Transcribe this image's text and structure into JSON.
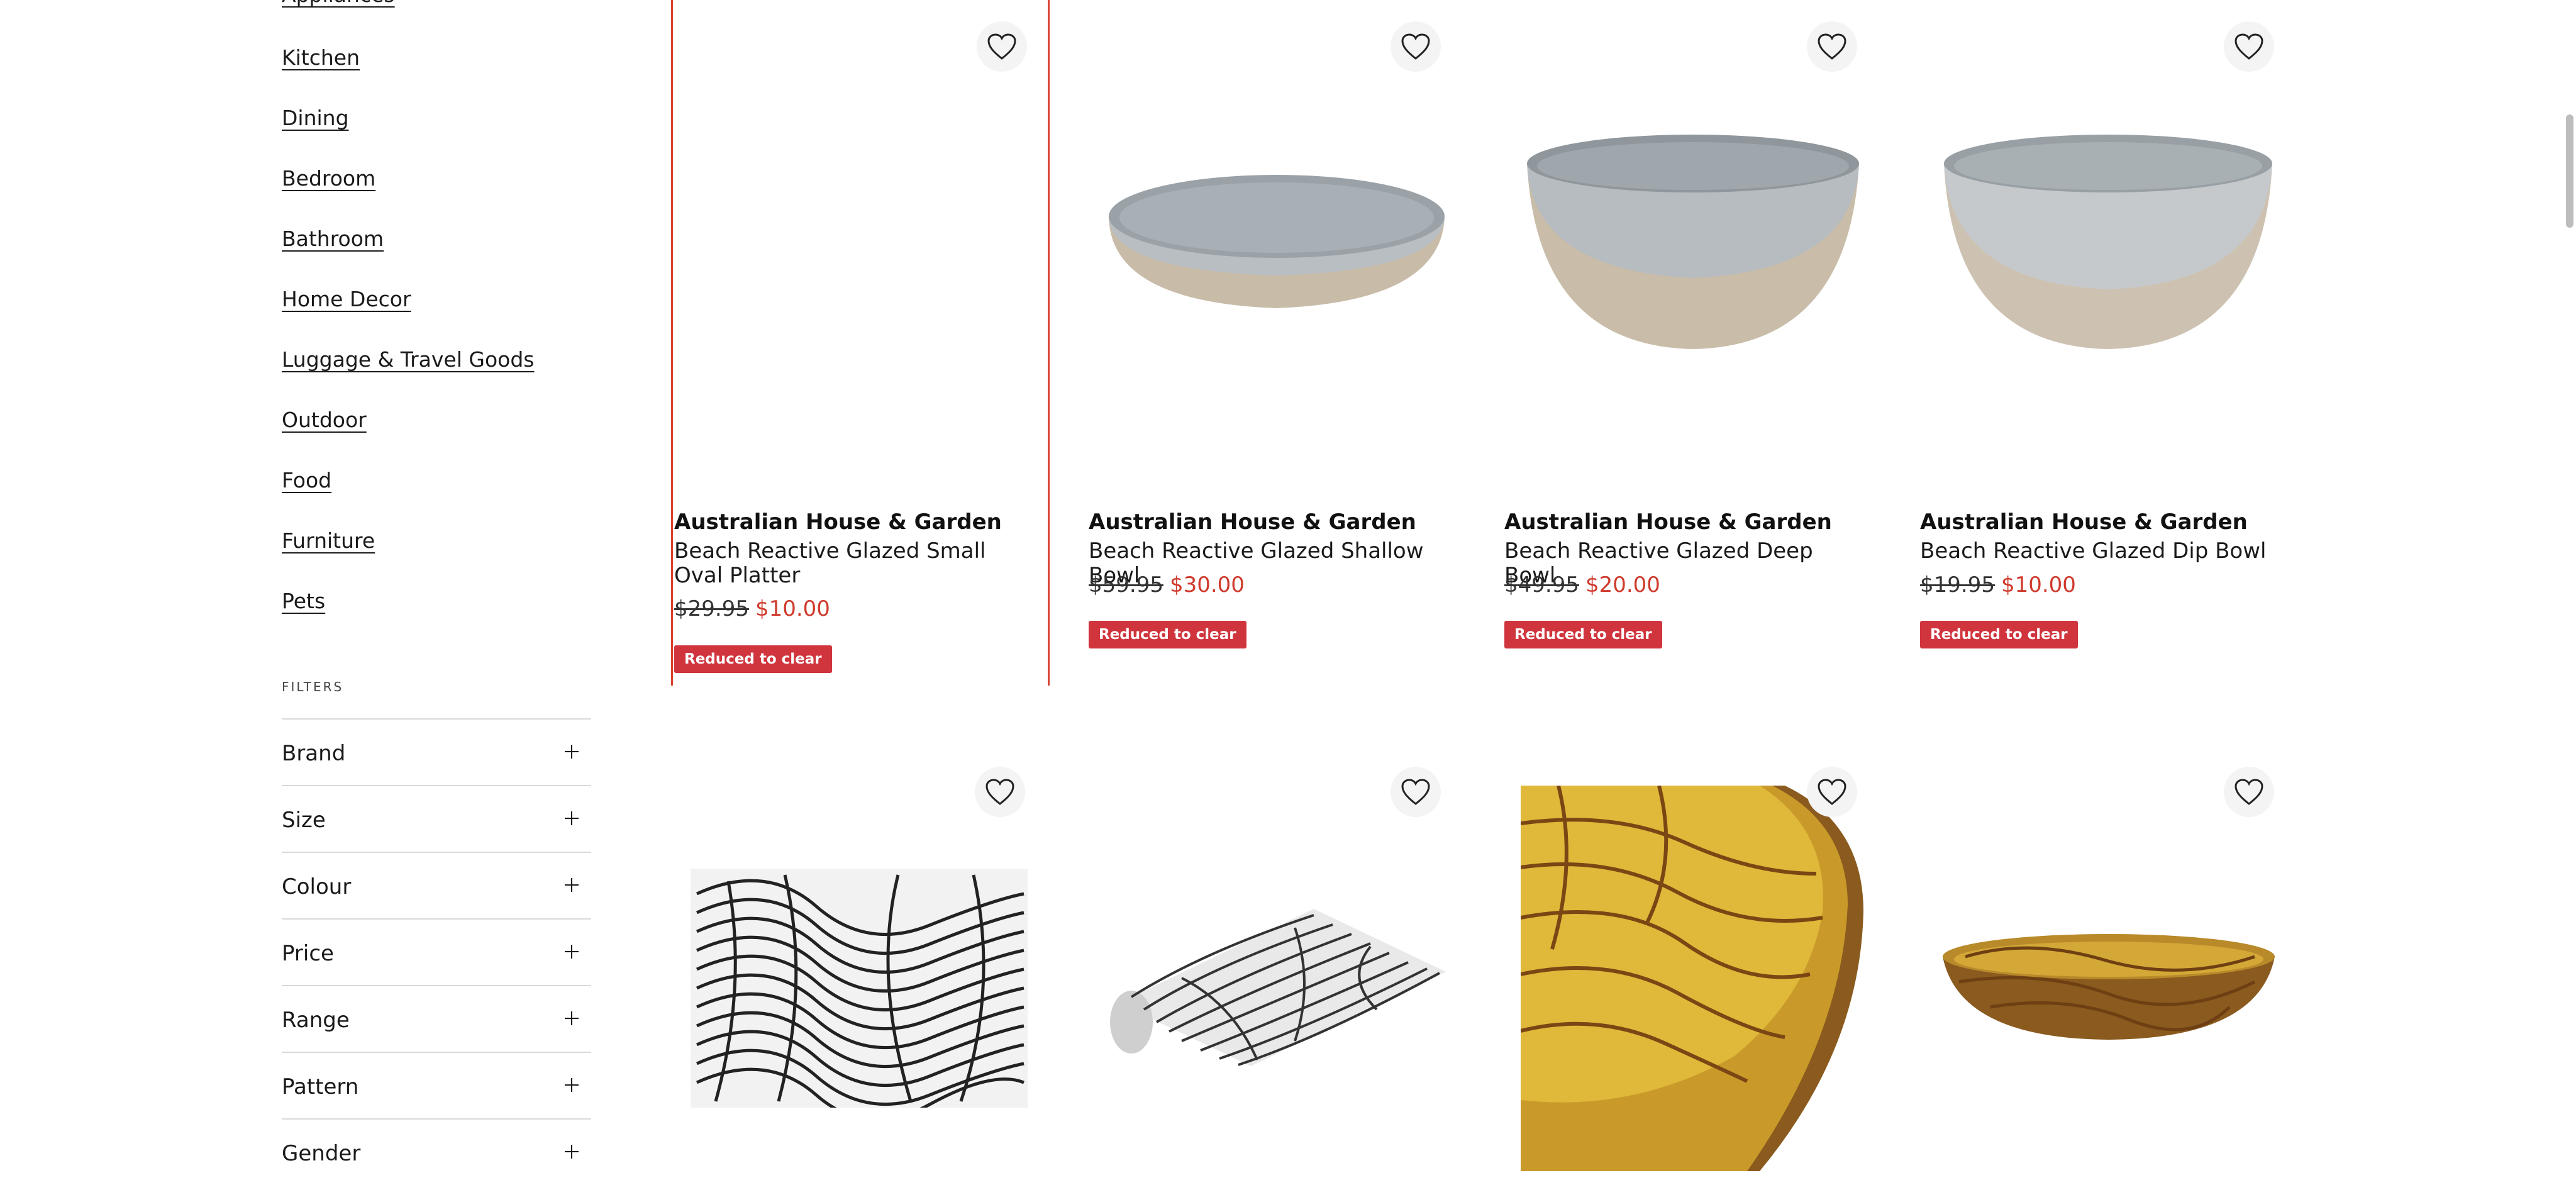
{
  "sidebar": {
    "categories": [
      "Appliances",
      "Kitchen",
      "Dining",
      "Bedroom",
      "Bathroom",
      "Home Decor",
      "Luggage & Travel Goods",
      "Outdoor",
      "Food",
      "Furniture",
      "Pets"
    ],
    "filters_heading": "FILTERS",
    "filters": [
      "Brand",
      "Size",
      "Colour",
      "Price",
      "Range",
      "Pattern",
      "Gender"
    ]
  },
  "products": [
    {
      "brand": "Australian House & Garden",
      "name": "Beach Reactive Glazed Small Oval Platter",
      "was": "$29.95",
      "now": "$10.00",
      "badge": "Reduced to clear",
      "image": "empty"
    },
    {
      "brand": "Australian House & Garden",
      "name": "Beach Reactive Glazed Shallow Bowl",
      "was": "$59.95",
      "now": "$30.00",
      "badge": "Reduced to clear",
      "image": "grey-shallow-bowl"
    },
    {
      "brand": "Australian House & Garden",
      "name": "Beach Reactive Glazed Deep Bowl",
      "was": "$49.95",
      "now": "$20.00",
      "badge": "Reduced to clear",
      "image": "grey-deep-bowl"
    },
    {
      "brand": "Australian House & Garden",
      "name": "Beach Reactive Glazed Dip Bowl",
      "was": "$19.95",
      "now": "$10.00",
      "badge": "Reduced to clear",
      "image": "grey-dip-bowl"
    },
    {
      "image": "black-white-swirl-placemat"
    },
    {
      "image": "black-white-swirl-runner"
    },
    {
      "image": "amber-swirl-large-bowl"
    },
    {
      "image": "amber-swirl-shallow-bowl"
    }
  ],
  "colors": {
    "sale": "#cf3a2c",
    "badge": "#d0343d",
    "selected_outline": "#d9412f"
  }
}
